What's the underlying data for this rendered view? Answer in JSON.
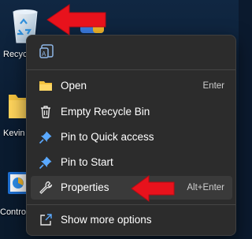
{
  "desktop": {
    "icons": [
      {
        "label": "Recycle Bin"
      },
      {
        "label": "Kevin"
      },
      {
        "label": "Control Panel"
      }
    ]
  },
  "menu": {
    "items": [
      {
        "label": "Open",
        "shortcut": "Enter",
        "icon": "folder-open-icon"
      },
      {
        "label": "Empty Recycle Bin",
        "icon": "trash-icon"
      },
      {
        "label": "Pin to Quick access",
        "icon": "pin-icon"
      },
      {
        "label": "Pin to Start",
        "icon": "pin-icon"
      },
      {
        "label": "Properties",
        "shortcut": "Alt+Enter",
        "icon": "wrench-icon"
      },
      {
        "label": "Show more options",
        "icon": "external-link-icon"
      }
    ],
    "highlighted_item": "Properties"
  },
  "colors": {
    "menu_bg": "#2c2c2c",
    "highlight": "#3a3a3a",
    "accent_pin": "#5aa9ff",
    "annotation_arrow": "#e8121c"
  }
}
